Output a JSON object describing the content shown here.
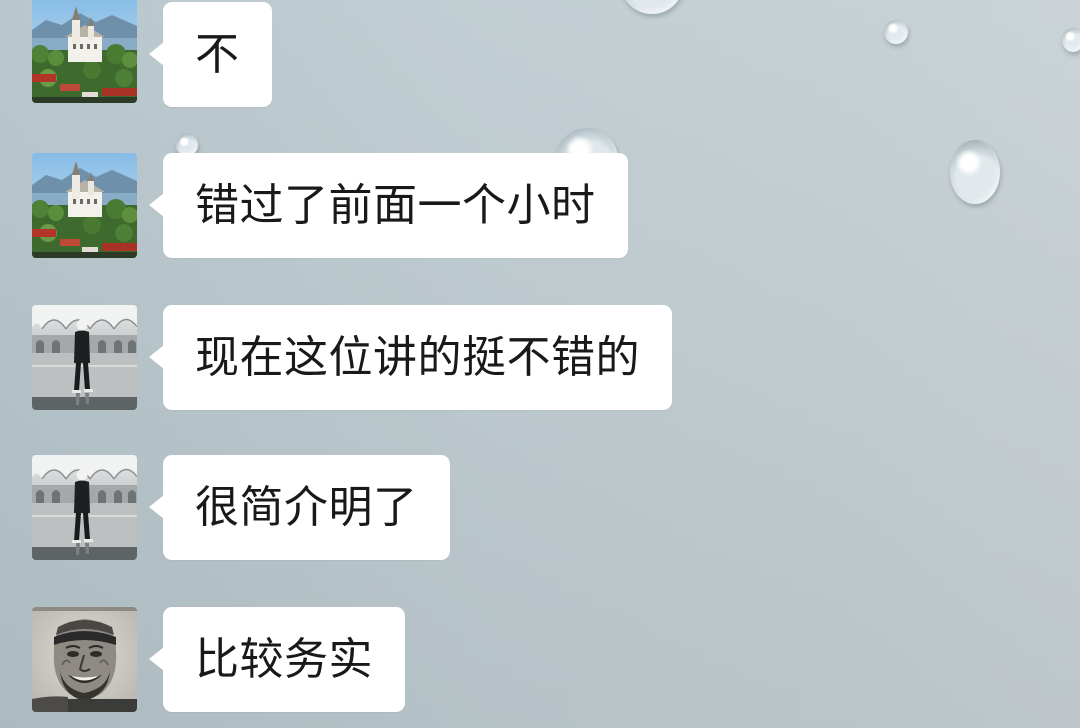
{
  "theme": {
    "bubble_color": "#ffffff",
    "text_color": "#191919",
    "background_color": "#c0cdd2"
  },
  "messages": [
    {
      "text": "不",
      "avatar_icon": "landscape-avatar"
    },
    {
      "text": "错过了前面一个小时",
      "avatar_icon": "landscape-avatar"
    },
    {
      "text": "现在这位讲的挺不错的",
      "avatar_icon": "person-walking-avatar"
    },
    {
      "text": "很简介明了",
      "avatar_icon": "person-walking-avatar"
    },
    {
      "text": "比较务实",
      "avatar_icon": "portrait-sketch-avatar"
    }
  ]
}
